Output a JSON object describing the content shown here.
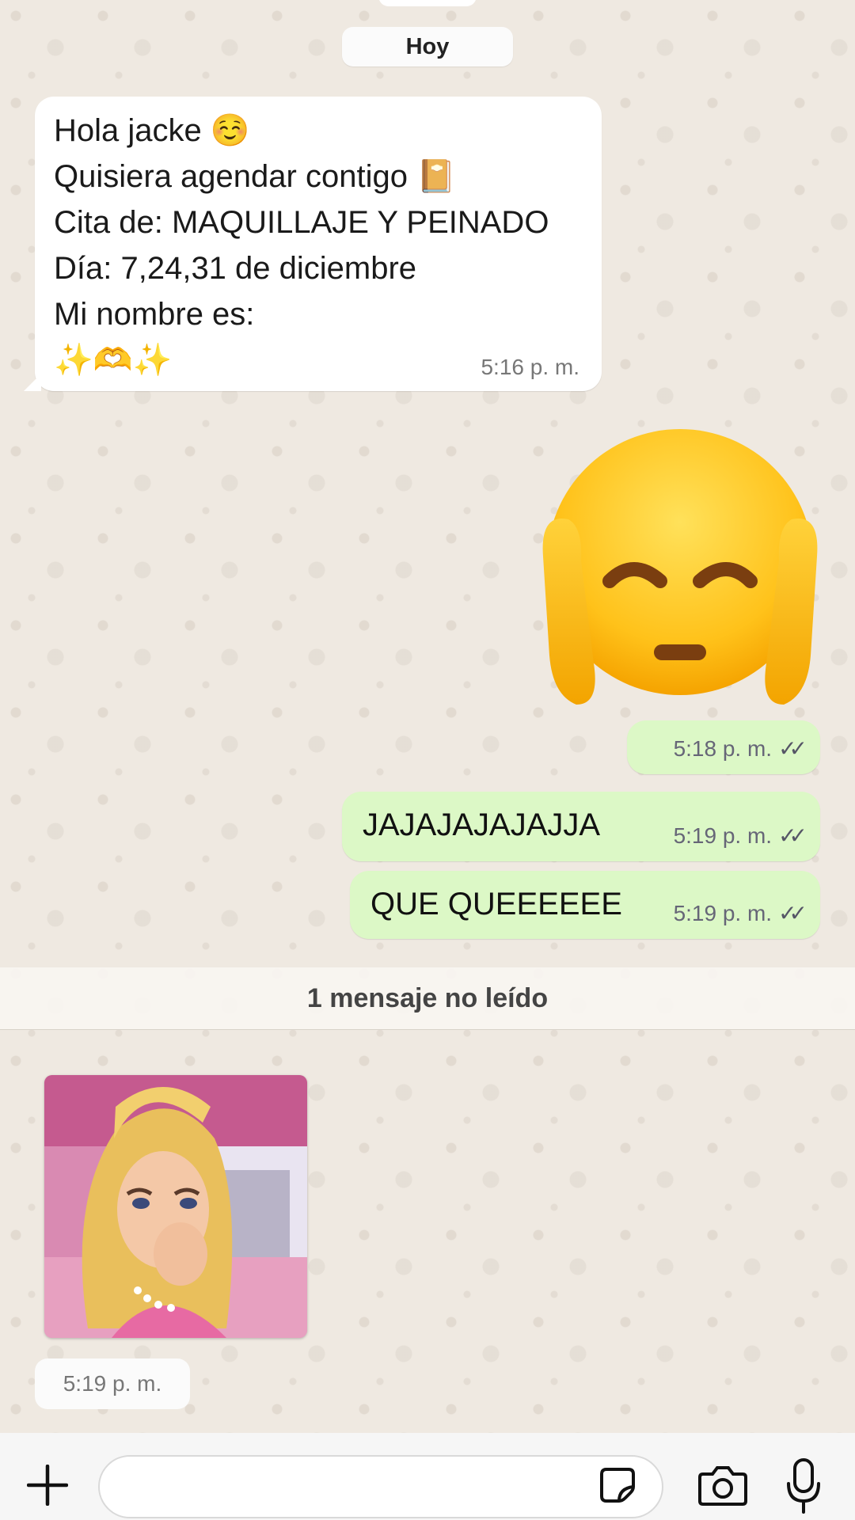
{
  "chat": {
    "date_label": "Hoy",
    "incoming_message": {
      "lines": [
        "Hola jacke ☺️",
        "Quisiera agendar contigo 📔",
        "Cita de: MAQUILLAJE Y PEINADO",
        "Día: 7,24,31 de diciembre",
        "Mi nombre es:",
        "✨🫶✨"
      ],
      "time": "5:16 p. m."
    },
    "outgoing_emoji": {
      "emoji_name": "face-with-hands-over-ears-emoji",
      "time": "5:18 p. m."
    },
    "outgoing_messages": [
      {
        "text": "JAJAJAJAJAJJA",
        "time": "5:19 p. m."
      },
      {
        "text": "QUE QUEEEEEE",
        "time": "5:19 p. m."
      }
    ],
    "read_ticks": "✓✓",
    "unread_label": "1 mensaje no leído",
    "sticker": {
      "subject": "barbie-laughing-sticker",
      "time": "5:19 p. m."
    }
  },
  "input_bar": {
    "icons": [
      "plus-icon",
      "sticker-icon",
      "camera-icon",
      "microphone-icon"
    ]
  },
  "colors": {
    "chat_background": "#efe9e1",
    "outgoing_bubble": "#dcf8c6",
    "incoming_bubble": "#ffffff"
  }
}
